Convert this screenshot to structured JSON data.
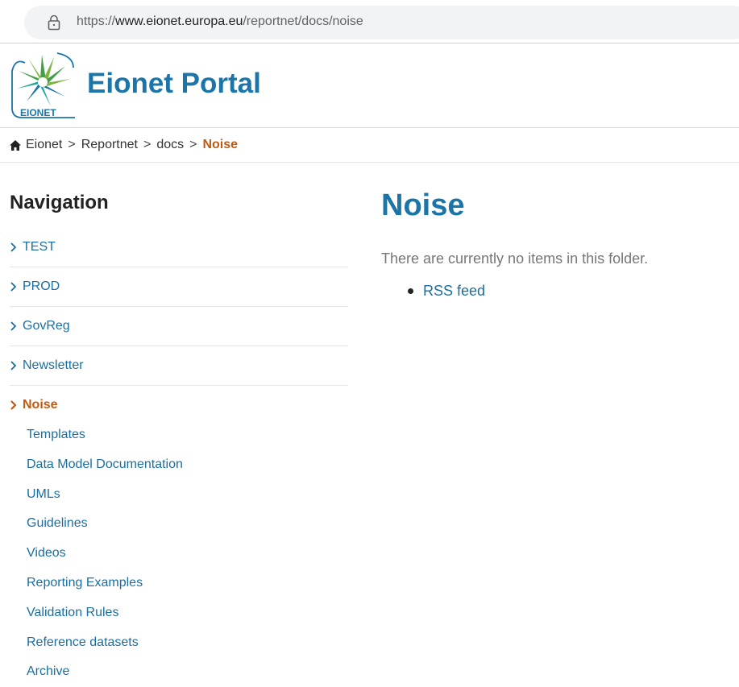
{
  "browser": {
    "url_prefix": "https://",
    "url_host": "www.eionet.europa.eu",
    "url_path": "/reportnet/docs/noise"
  },
  "header": {
    "title": "Eionet Portal",
    "logo_text": "EIONET"
  },
  "breadcrumb": {
    "items": [
      "Eionet",
      "Reportnet",
      "docs"
    ],
    "current": "Noise",
    "separator": ">"
  },
  "navigation": {
    "title": "Navigation",
    "items": [
      "TEST",
      "PROD",
      "GovReg",
      "Newsletter"
    ],
    "active": "Noise",
    "sub_items": [
      "Templates",
      "Data Model Documentation",
      "UMLs",
      "Guidelines",
      "Videos",
      "Reporting Examples",
      "Validation Rules",
      "Reference datasets",
      "Archive"
    ]
  },
  "main": {
    "title": "Noise",
    "empty_message": "There are currently no items in this folder.",
    "rss_label": "RSS feed"
  },
  "colors": {
    "brand_blue": "#1b75a9",
    "link_blue": "#1b6fa0",
    "active_orange": "#c05b12",
    "logo_green": "#43a047"
  }
}
